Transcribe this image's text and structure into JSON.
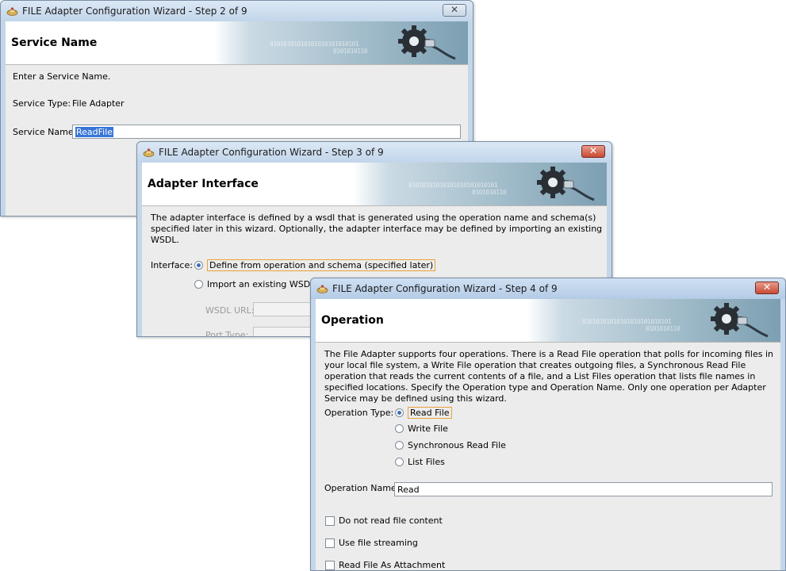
{
  "window_step2": {
    "title": "FILE Adapter Configuration Wizard - Step 2 of 9",
    "header": "Service Name",
    "instruction": "Enter a Service Name.",
    "service_type_label": "Service Type:",
    "service_type_value": "File Adapter",
    "service_name_label": "Service Name:",
    "service_name_value": "ReadFile"
  },
  "window_step3": {
    "title": "FILE Adapter Configuration Wizard - Step 3 of 9",
    "header": "Adapter Interface",
    "description": "The adapter interface is defined by a wsdl that is generated using the operation name and schema(s) specified later in this wizard.  Optionally, the adapter interface may be defined by importing an existing WSDL.",
    "interface_label": "Interface:",
    "options": [
      "Define from operation and schema (specified later)",
      "Import an existing WSDL"
    ],
    "selected_option": "Define from operation and schema (specified later)",
    "wsdl_url_label": "WSDL URL:",
    "port_type_label": "Port Type:"
  },
  "window_step4": {
    "title": "FILE Adapter Configuration Wizard - Step 4 of 9",
    "header": "Operation",
    "description": "The File Adapter supports four operations.  There is a Read File operation that polls for incoming files in your local file system, a Write File operation that creates outgoing files, a Synchronous Read File operation that reads the current contents of a file, and a List Files operation that lists file names in specified locations.  Specify the Operation type and Operation Name.  Only one operation per Adapter Service may be defined using this wizard.",
    "operation_type_label": "Operation Type:",
    "operation_types": [
      "Read File",
      "Write File",
      "Synchronous Read File",
      "List Files"
    ],
    "selected_operation_type": "Read File",
    "operation_name_label": "Operation Name:",
    "operation_name_value": "Read",
    "checkboxes": [
      {
        "label": "Do not read file content",
        "checked": false
      },
      {
        "label": "Use file streaming",
        "checked": false
      },
      {
        "label": "Read File As Attachment",
        "checked": false
      }
    ]
  },
  "decor": {
    "binary_text": "01010101010101010101010101",
    "binary_text_2": "0101010110"
  },
  "icons": [
    "wizard-app-icon",
    "close-icon",
    "gear-plug-icon"
  ],
  "colors": {
    "selection": "#3875d7",
    "focus_border": "#e9a23b",
    "active_close": "#c74a34",
    "dialog_bg": "#ececec"
  }
}
